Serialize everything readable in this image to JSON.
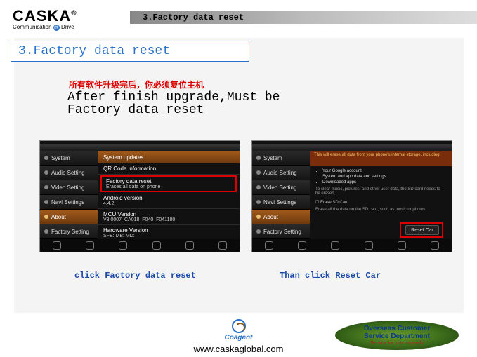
{
  "logo": {
    "main": "CASKA",
    "tagline_a": "Communication",
    "tagline_b": "Drive"
  },
  "header": {
    "title": "3.Factory data reset"
  },
  "subtitle": "3.Factory data reset",
  "notes": {
    "red": "所有软件升级完后，你必须复位主机",
    "black": "After finish upgrade,Must be Factory data reset"
  },
  "sidebar_items": [
    "System",
    "Audio Setting",
    "Video Setting",
    "Navi Settings",
    "About",
    "Factory Setting"
  ],
  "shot1": {
    "header": "System updates",
    "row_a_label": "QR Code information",
    "row_b_label": "Factory data reset",
    "row_b_sub": "Erases all data on phone",
    "row_c_label": "Android version",
    "row_c_sub": "4.4.2",
    "row_d_label": "MCU Version",
    "row_d_sub": "V3.0007_CA018_F040_F041180",
    "row_e_label": "Hardware Version",
    "row_e_sub": "SFE:\nMB:\nMD:"
  },
  "shot2": {
    "warn": "This will erase all data from your phone's internal storage, including:",
    "bullets": [
      "Your Google account",
      "System and app data and settings",
      "Downloaded apps"
    ],
    "note1": "To clear music, pictures, and other user data, the SD card needs to be erased.",
    "chk": "Erase SD Card",
    "note2": "Erase all the data on the SD card, such as music or photos",
    "button": "Reset Car"
  },
  "captions": {
    "c1": "click Factory data reset",
    "c2": "Than click Reset Car"
  },
  "footer": {
    "brand": "Coagent",
    "url": "www.caskaglobal.com",
    "dept_l1a": "Overseas Customer",
    "dept_l1b": "Service Department",
    "dept_l2": "Service for you sincerely"
  }
}
